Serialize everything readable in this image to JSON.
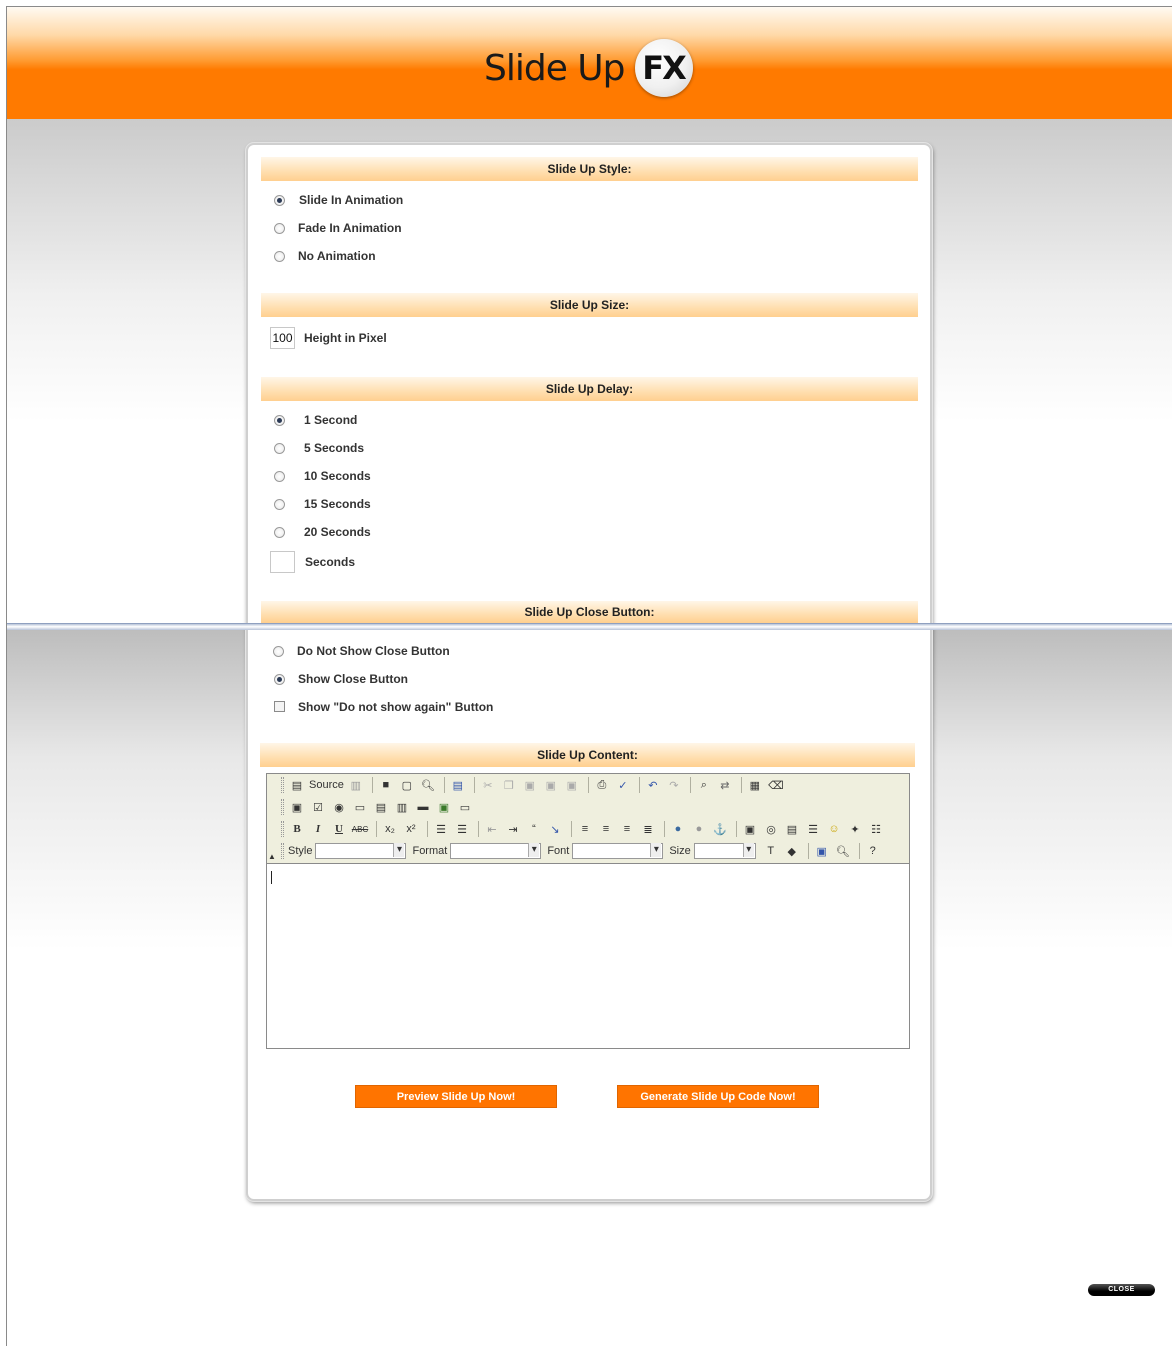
{
  "header": {
    "logo_text": "Slide Up",
    "logo_badge": "FX"
  },
  "sections": {
    "style": {
      "title": "Slide Up Style:",
      "options": [
        {
          "label": "Slide In Animation",
          "checked": true
        },
        {
          "label": "Fade In Animation",
          "checked": false
        },
        {
          "label": "No Animation",
          "checked": false
        }
      ]
    },
    "size": {
      "title": "Slide Up Size:",
      "value": "100",
      "label": "Height in Pixel"
    },
    "delay": {
      "title": "Slide Up Delay:",
      "options": [
        {
          "label": "1 Second",
          "checked": true
        },
        {
          "label": "5 Seconds",
          "checked": false
        },
        {
          "label": "10 Seconds",
          "checked": false
        },
        {
          "label": "15 Seconds",
          "checked": false
        },
        {
          "label": "20 Seconds",
          "checked": false
        }
      ],
      "custom_value": "",
      "custom_label": "Seconds"
    },
    "close_button": {
      "title": "Slide Up Close Button:",
      "options": [
        {
          "label": "Do Not Show Close Button",
          "checked": false
        },
        {
          "label": "Show Close Button",
          "checked": true
        }
      ],
      "checkbox_label": "Show \"Do not show again\" Button",
      "checkbox_checked": false
    },
    "content": {
      "title": "Slide Up Content:"
    }
  },
  "editor": {
    "source_label": "Source",
    "style_label": "Style",
    "format_label": "Format",
    "font_label": "Font",
    "size_label": "Size",
    "content": ""
  },
  "buttons": {
    "preview": "Preview Slide Up Now!",
    "generate": "Generate Slide Up Code Now!",
    "close": "CLOSE"
  }
}
